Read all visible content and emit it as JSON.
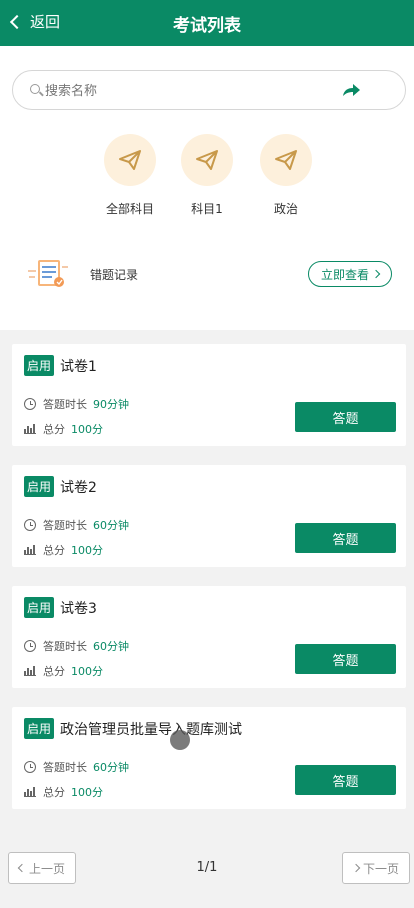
{
  "header": {
    "back_label": "返回",
    "title": "考试列表"
  },
  "search": {
    "placeholder": "搜索名称",
    "value": ""
  },
  "categories": [
    {
      "label": "全部科目",
      "icon": "paper-plane-icon"
    },
    {
      "label": "科目1",
      "icon": "paper-plane-icon"
    },
    {
      "label": "政治",
      "icon": "paper-plane-icon"
    }
  ],
  "wrong_record": {
    "label": "错题记录",
    "button": "立即查看"
  },
  "exams": [
    {
      "status": "启用",
      "name": "试卷1",
      "duration_label": "答题时长",
      "duration": "90分钟",
      "score_label": "总分",
      "score": "100分",
      "button": "答题"
    },
    {
      "status": "启用",
      "name": "试卷2",
      "duration_label": "答题时长",
      "duration": "60分钟",
      "score_label": "总分",
      "score": "100分",
      "button": "答题"
    },
    {
      "status": "启用",
      "name": "试卷3",
      "duration_label": "答题时长",
      "duration": "60分钟",
      "score_label": "总分",
      "score": "100分",
      "button": "答题"
    },
    {
      "status": "启用",
      "name": "政治管理员批量导入题库测试",
      "duration_label": "答题时长",
      "duration": "60分钟",
      "score_label": "总分",
      "score": "100分",
      "button": "答题"
    }
  ],
  "pager": {
    "prev": "上一页",
    "next": "下一页",
    "page": "1/1"
  },
  "colors": {
    "primary": "#0a8a65",
    "icon_bg": "#fdf0dc",
    "icon_stroke": "#c8994a"
  }
}
